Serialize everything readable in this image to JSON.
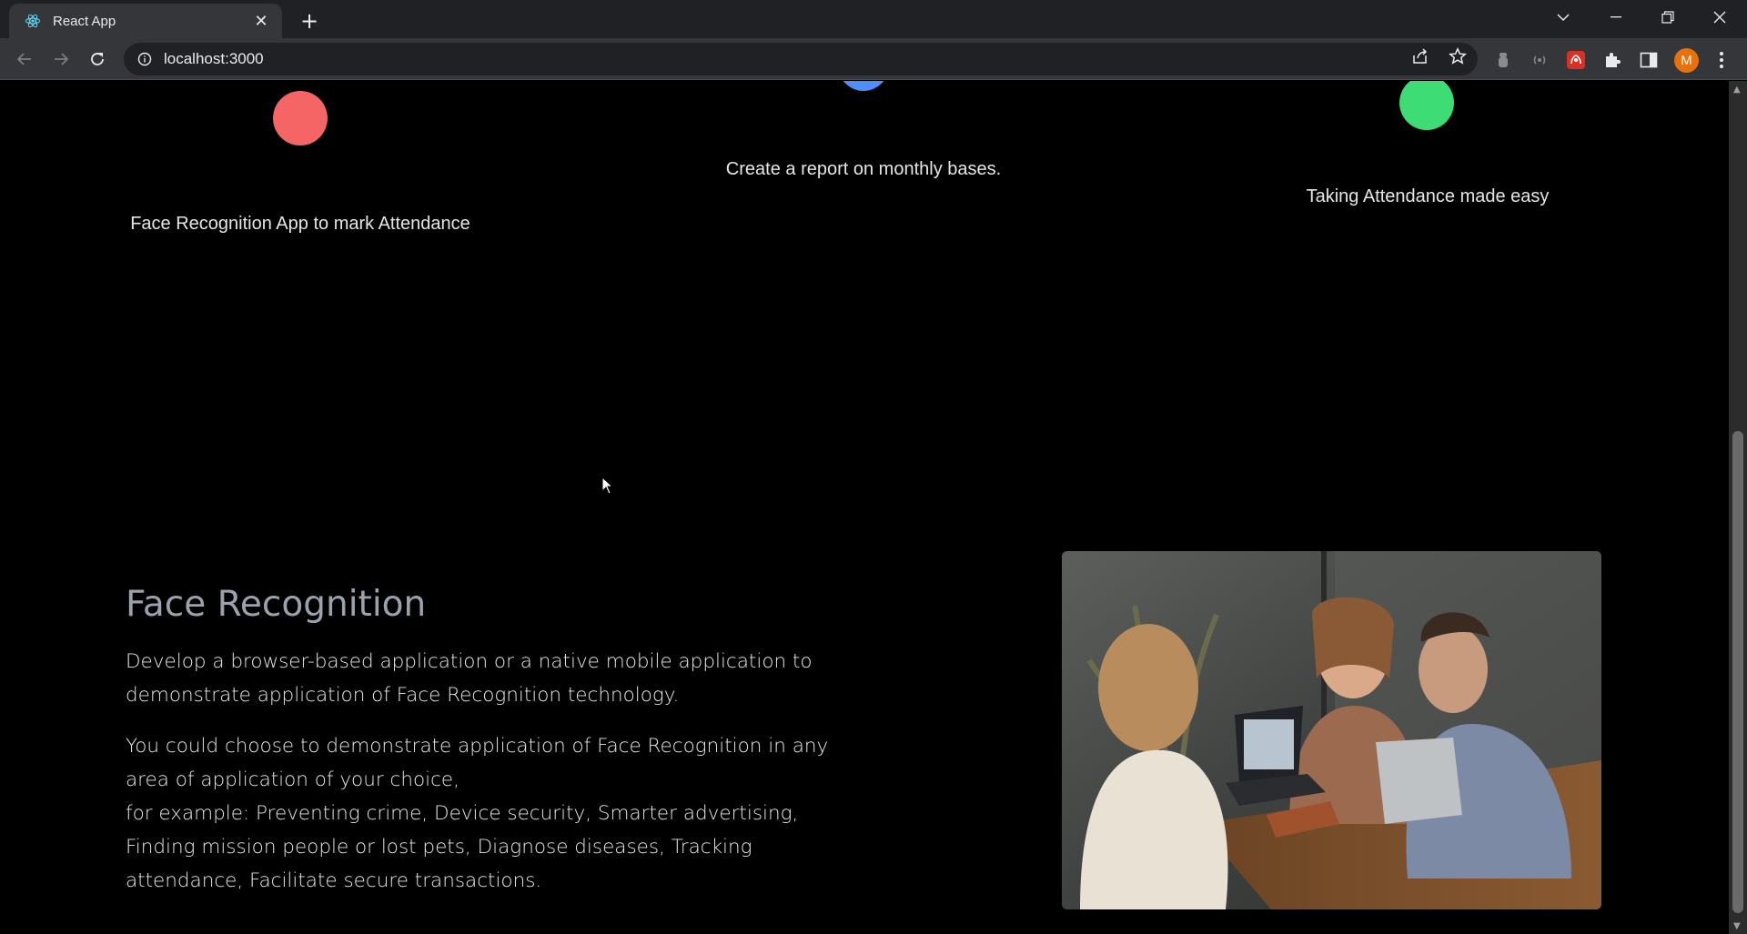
{
  "browser": {
    "tab_title": "React App",
    "url": "localhost:3000",
    "profile_initial": "M"
  },
  "features": [
    {
      "text": "Face Recognition App to mark Attendance",
      "color": "#f56565"
    },
    {
      "text": "Create a report on monthly bases.",
      "color": "#4f8ef7"
    },
    {
      "text": "Taking Attendance made easy",
      "color": "#3ddc74"
    }
  ],
  "section": {
    "title": "Face Recognition",
    "paragraph1": "Develop a browser-based application or a native mobile application to demonstrate application of Face Recognition technology.",
    "paragraph2_line1": "You could choose to demonstrate application of Face Recognition in any area of application of your choice,",
    "paragraph2_line2": "for example: Preventing crime, Device security, Smarter advertising, Finding mission people or lost pets, Diagnose diseases, Tracking attendance, Facilitate secure transactions."
  }
}
